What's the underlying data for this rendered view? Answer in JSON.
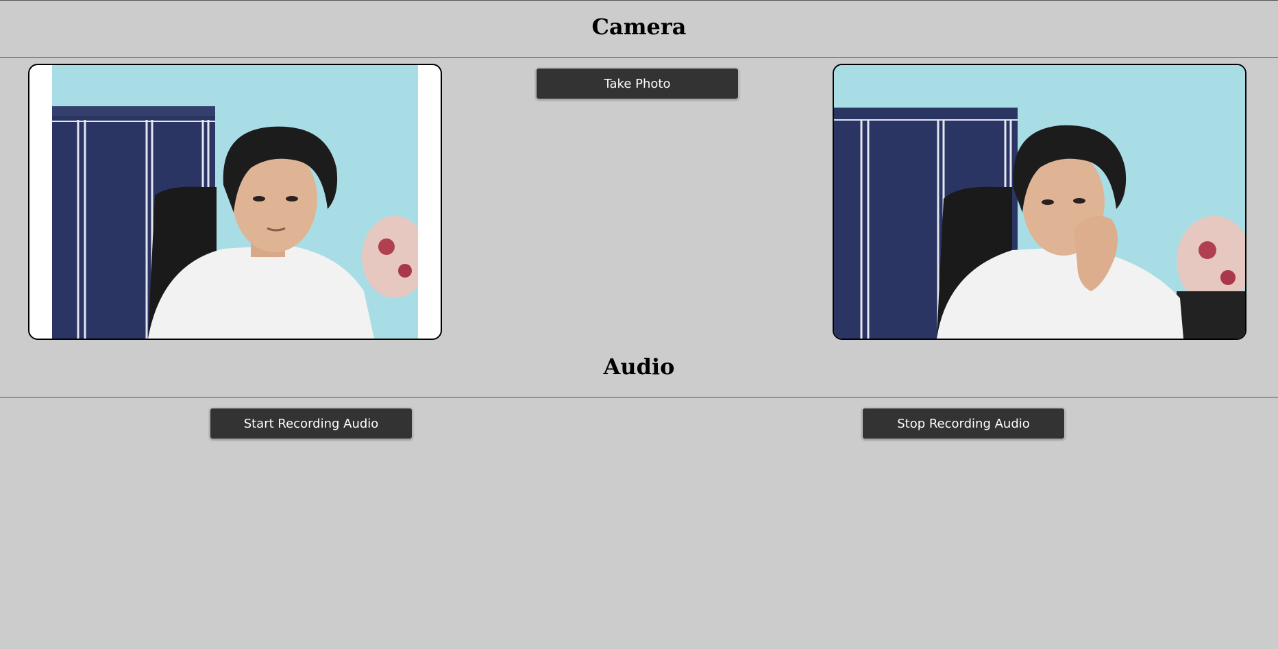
{
  "camera": {
    "title": "Camera",
    "take_photo_label": "Take Photo",
    "live_preview": {
      "icon": "webcam-live-video"
    },
    "captured_photo": {
      "icon": "captured-photo"
    }
  },
  "audio": {
    "title": "Audio",
    "start_label": "Start Recording Audio",
    "stop_label": "Stop Recording Audio"
  },
  "colors": {
    "background": "#cccccc",
    "button_bg": "#333333",
    "button_text": "#ffffff",
    "wall": "#a8dde6",
    "wardrobe": "#2a3563",
    "shirt": "#f2f2f2"
  }
}
